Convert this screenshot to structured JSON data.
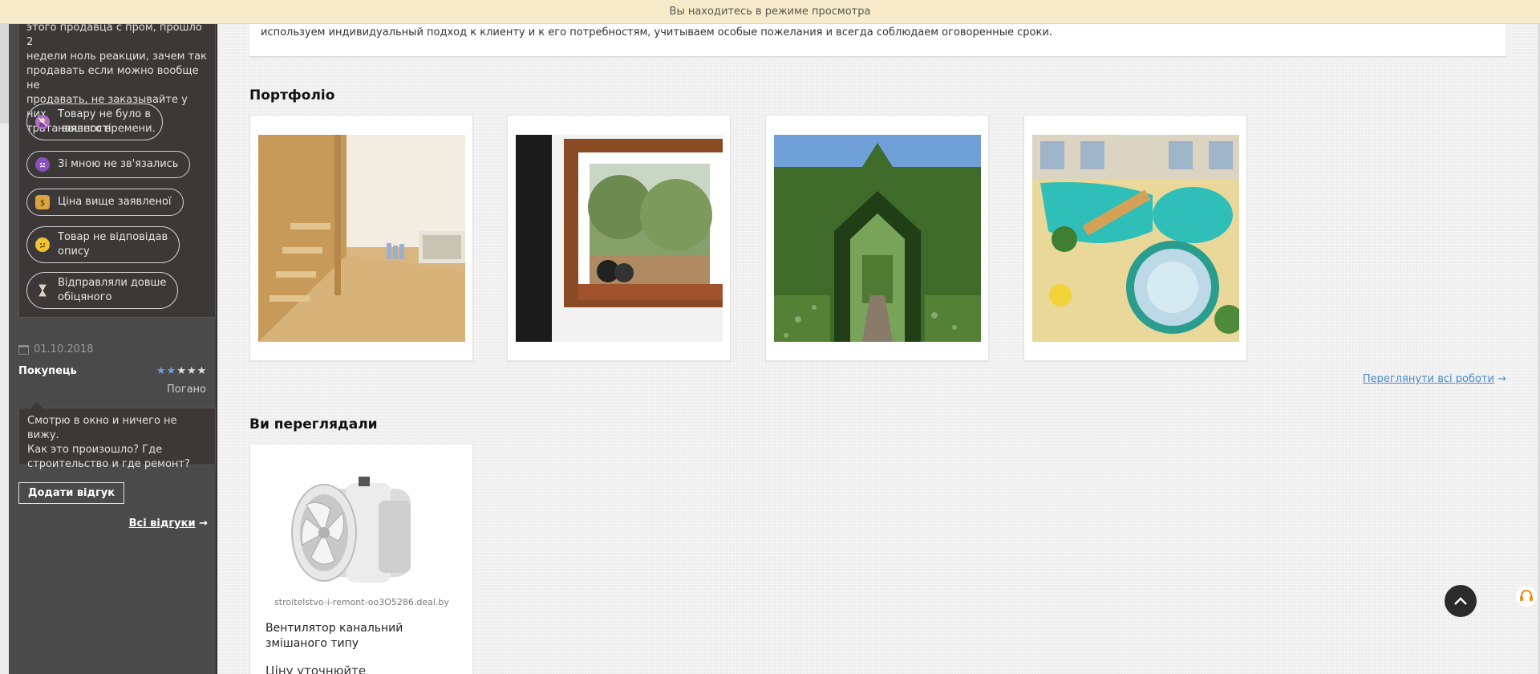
{
  "preview_bar": {
    "text": "Вы находитесь в режиме просмотра"
  },
  "sidebar": {
    "review": {
      "text_lines": [
        "этого продавца с пром, прошло 2",
        "недели ноль реакции, зачем так",
        "продавать если можно вообще не",
        "продавать, не заказывайте у них",
        "трата вашего времени."
      ],
      "tags": [
        {
          "lines": [
            "Товару не було в",
            "наявності"
          ],
          "icon": "person-no-icon",
          "color": "#b070c0"
        },
        {
          "lines": [
            "Зі мною не зв'язались"
          ],
          "icon": "angry-devil-icon",
          "color": "#8a4fbf"
        },
        {
          "lines": [
            "Ціна вище заявленої"
          ],
          "icon": "money-bag-icon",
          "color": "#d9a441"
        },
        {
          "lines": [
            "Товар не відповідав",
            "опису"
          ],
          "icon": "confused-face-icon",
          "color": "#f2c230"
        },
        {
          "lines": [
            "Відправляли довше",
            "обіцяного"
          ],
          "icon": "hourglass-icon",
          "color": "#c8c8c8"
        }
      ]
    },
    "second_review": {
      "date": "01.10.2018",
      "author": "Покупець",
      "stars_filled": 2,
      "stars_total": 5,
      "rating_label": "Погано",
      "comment_lines": [
        "Смотрю в окно и ничего не вижу.",
        "Как это произошло? Где",
        "строительство и где ремонт?"
      ]
    },
    "add_review_label": "Додати відгук",
    "all_reviews_label": "Всі відгуки",
    "all_reviews_arrow": "→"
  },
  "about": {
    "text": "используем индивидуальный подход к клиенту и к его потребностям, учитываем особые пожелания и всегда соблюдаем оговоренные сроки."
  },
  "portfolio": {
    "title": "Портфоліо",
    "items": [
      {
        "image": "wooden-staircase-interior"
      },
      {
        "image": "window-seat-nook"
      },
      {
        "image": "hedge-archway-garden"
      },
      {
        "image": "indoor-pool-jacuzzi"
      }
    ],
    "view_all_label": "Переглянути всі роботи",
    "view_all_arrow": "→"
  },
  "viewed": {
    "title": "Ви переглядали",
    "product": {
      "name": "Вентилятор канальний змішаного типу",
      "price": "Ціну уточнюйте",
      "watermark": "stroitelstvo-i-remont-oo3O5286.deal.by",
      "image": "duct-fan"
    }
  }
}
